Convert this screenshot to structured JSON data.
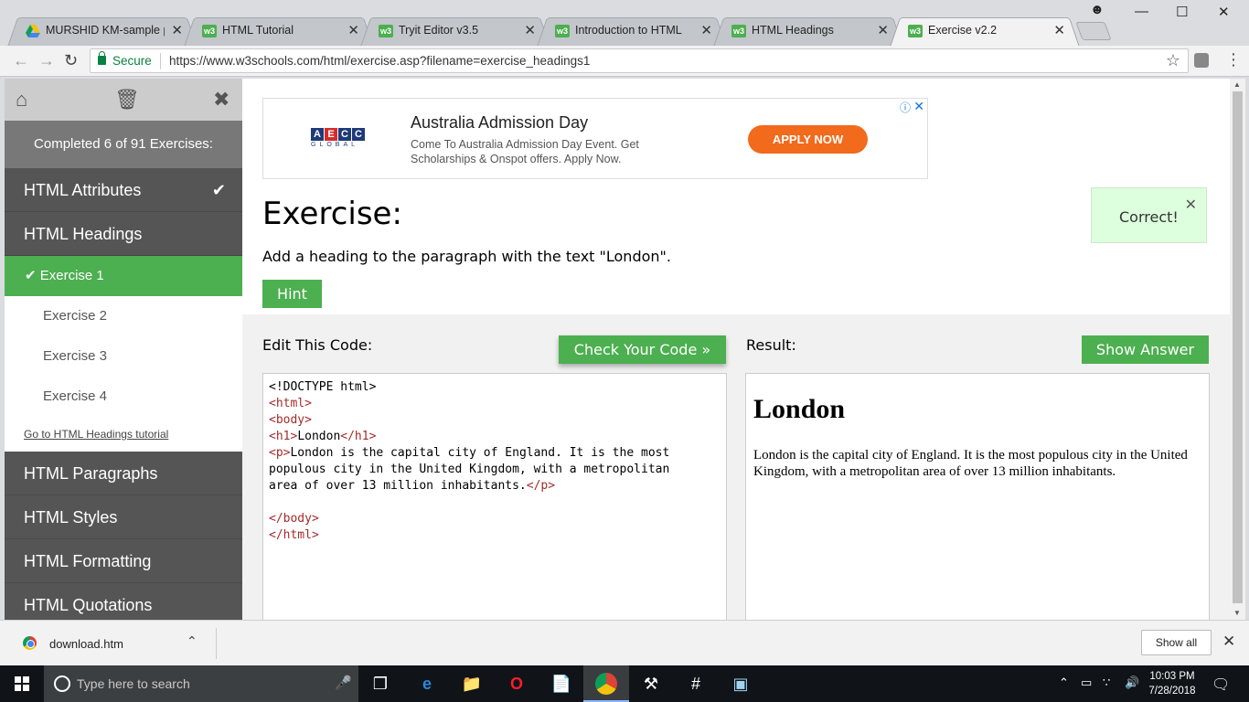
{
  "browser": {
    "tabs": [
      {
        "title": "MURSHID KM-sample pr",
        "icon": "google-drive-icon",
        "active": false
      },
      {
        "title": "HTML Tutorial",
        "icon": "w3schools-icon",
        "active": false
      },
      {
        "title": "Tryit Editor v3.5",
        "icon": "w3schools-icon",
        "active": false
      },
      {
        "title": "Introduction to HTML",
        "icon": "w3schools-icon",
        "active": false
      },
      {
        "title": "HTML Headings",
        "icon": "w3schools-icon",
        "active": false
      },
      {
        "title": "Exercise v2.2",
        "icon": "w3schools-icon",
        "active": true
      }
    ],
    "favicon_text": "w3",
    "close_glyph": "✕",
    "secure_label": "Secure",
    "url": "https://www.w3schools.com/html/exercise.asp?filename=exercise_headings1"
  },
  "sidebar": {
    "completed": "Completed 6 of 91 Exercises:",
    "items_before": [
      {
        "label": "HTML Attributes",
        "checked": true
      }
    ],
    "current_chapter": "HTML Headings",
    "exercises": [
      {
        "label": "Exercise 1",
        "done": true
      },
      {
        "label": "Exercise 2",
        "done": false
      },
      {
        "label": "Exercise 3",
        "done": false
      },
      {
        "label": "Exercise 4",
        "done": false
      }
    ],
    "tutorial_link": "Go to HTML Headings tutorial",
    "items_after": [
      "HTML Paragraphs",
      "HTML Styles",
      "HTML Formatting",
      "HTML Quotations"
    ]
  },
  "ad": {
    "logo_letters": [
      "A",
      "E",
      "C",
      "C"
    ],
    "logo_sub": "GLOBAL",
    "title": "Australia Admission Day",
    "description": "Come To Australia Admission Day Event. Get Scholarships & Onspot offers. Apply Now.",
    "button": "APPLY NOW",
    "info_glyph": "ⓘ",
    "close_glyph": "✕"
  },
  "exercise": {
    "title": "Exercise:",
    "instruction": "Add a heading to the paragraph with the text \"London\".",
    "hint_label": "Hint",
    "correct_label": "Correct!",
    "edit_label": "Edit This Code:",
    "check_label": "Check Your Code »",
    "result_label": "Result:",
    "answer_label": "Show Answer",
    "code_lines": [
      [
        {
          "t": "<!DOCTYPE html>",
          "c": "plain"
        }
      ],
      [
        {
          "t": "<html>",
          "c": "tag"
        }
      ],
      [
        {
          "t": "<body>",
          "c": "tag"
        }
      ],
      [
        {
          "t": "<h1>",
          "c": "tag"
        },
        {
          "t": "London",
          "c": "plain"
        },
        {
          "t": "</h1>",
          "c": "tag"
        }
      ],
      [
        {
          "t": "<p>",
          "c": "tag"
        },
        {
          "t": "London is the capital city of England. It is the most",
          "c": "plain"
        }
      ],
      [
        {
          "t": "populous city in the United Kingdom, with a metropolitan",
          "c": "plain"
        }
      ],
      [
        {
          "t": "area of over 13 million inhabitants.",
          "c": "plain"
        },
        {
          "t": "</p>",
          "c": "tag"
        }
      ],
      [
        {
          "t": "",
          "c": "plain"
        }
      ],
      [
        {
          "t": "</body>",
          "c": "tag"
        }
      ],
      [
        {
          "t": "</html>",
          "c": "tag"
        }
      ]
    ],
    "result_heading": "London",
    "result_paragraph": "London is the capital city of England. It is the most populous city in the United Kingdom, with a metropolitan area of over 13 million inhabitants."
  },
  "download": {
    "filename": "download.htm",
    "show_all": "Show all"
  },
  "taskbar": {
    "search_placeholder": "Type here to search",
    "time": "10:03 PM",
    "date": "7/28/2018"
  },
  "colors": {
    "accent_green": "#4caf50",
    "sidebar_dark": "#555555",
    "ad_orange": "#f26a1b"
  }
}
